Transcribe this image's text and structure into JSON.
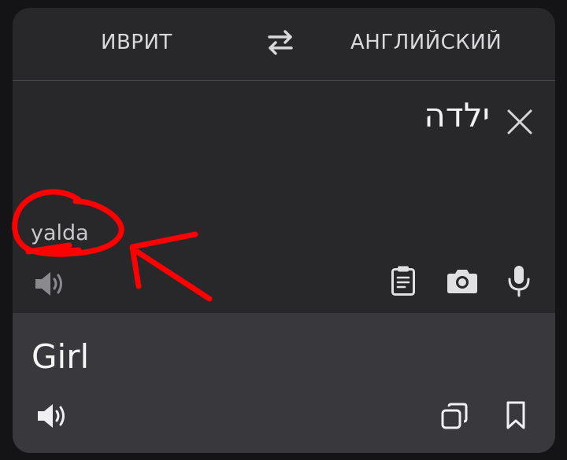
{
  "languages": {
    "source": "ИВРИТ",
    "target": "АНГЛИЙСКИЙ"
  },
  "input": {
    "text": "ילדה",
    "transliteration": "yalda"
  },
  "output": {
    "text": "Girl"
  },
  "icons": {
    "swap": "swap-arrows-icon",
    "clear": "close-icon",
    "source_audio": "speaker-icon",
    "clipboard": "clipboard-icon",
    "camera": "camera-icon",
    "mic": "microphone-icon",
    "output_audio": "speaker-icon",
    "copy": "copy-icon",
    "bookmark": "bookmark-icon"
  },
  "colors": {
    "background": "#141416",
    "card": "#28282b",
    "output_panel": "#39393d",
    "annotation": "#ff0000"
  }
}
